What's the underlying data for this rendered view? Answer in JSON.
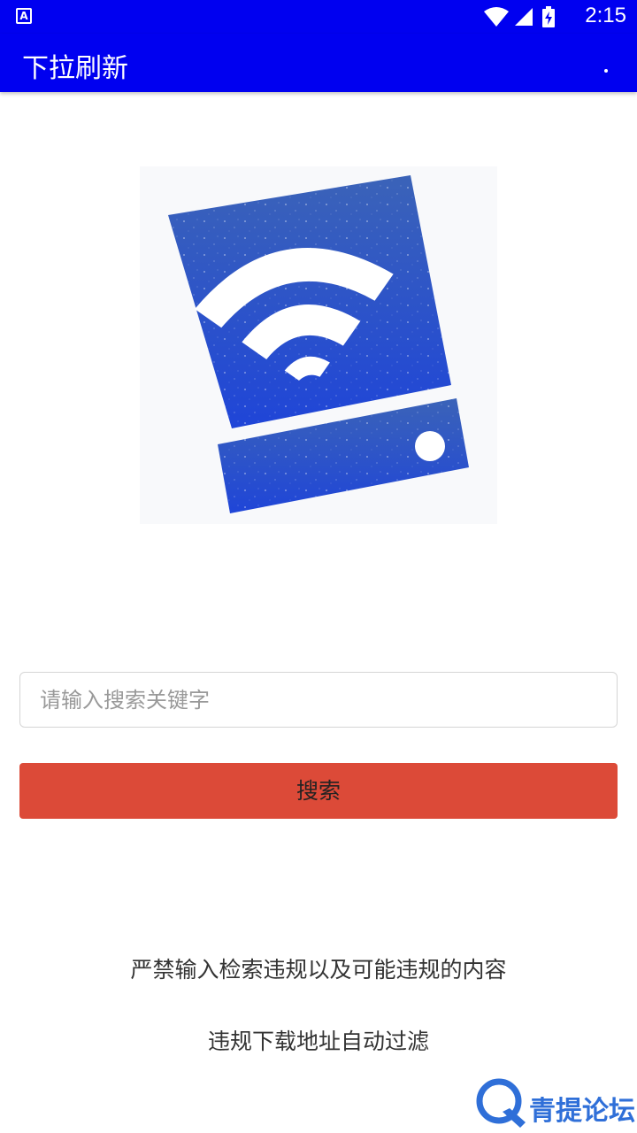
{
  "status_bar": {
    "time": "2:15",
    "notification_icon": "a-notification-icon",
    "icons": [
      "wifi-icon",
      "signal-icon",
      "battery-charging-icon"
    ]
  },
  "app_bar": {
    "title": "下拉刷新",
    "menu_icon": "overflow-menu-icon",
    "color": "#0000f0"
  },
  "logo": {
    "icon": "wifi-drive-logo",
    "color": "#2a4fd6"
  },
  "search": {
    "placeholder": "请输入搜索关键字",
    "value": "",
    "button_label": "搜索",
    "button_color": "#dc4a38"
  },
  "notices": [
    "严禁输入检索违规以及可能违规的内容",
    "违规下载地址自动过滤"
  ],
  "watermark": {
    "text": "青提论坛",
    "color": "#2f6fd8"
  }
}
